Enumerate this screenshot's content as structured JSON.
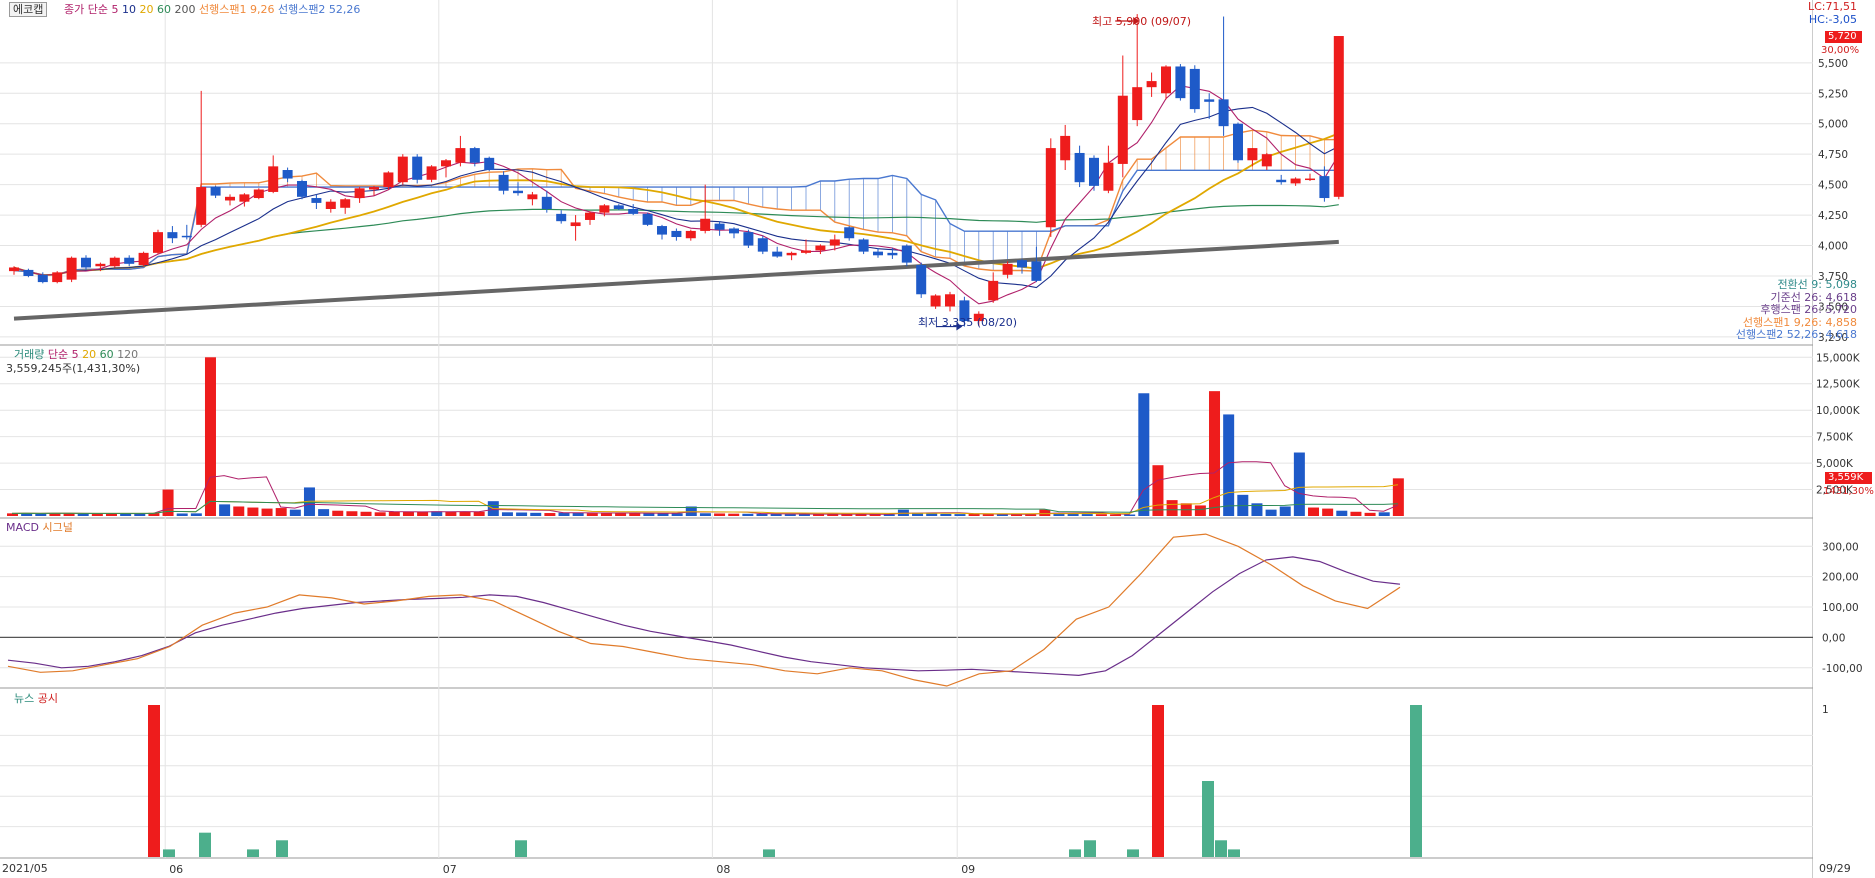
{
  "panels": {
    "price": {
      "stock_button": "에코캡",
      "legend": [
        {
          "text": "종가 단순",
          "color": "#b0206a"
        },
        {
          "text": "5",
          "color": "#b0206a"
        },
        {
          "text": "10",
          "color": "#1a2f8c"
        },
        {
          "text": "20",
          "color": "#e0a800"
        },
        {
          "text": "60",
          "color": "#2e8b57"
        },
        {
          "text": "200",
          "color": "#555555"
        },
        {
          "text": "선행스팬1 9,26",
          "color": "#f08a3c"
        },
        {
          "text": "선행스팬2 52,26",
          "color": "#4a78d0"
        }
      ],
      "lc": "LC:71,51",
      "hc": "HC:-3,05",
      "top_tag": "5,720",
      "top_pct": "30,00%",
      "high_note": "최고 5,900 (09/07)",
      "low_note": "최저 3,335 (08/20)",
      "y_ticks": [
        "5,500",
        "5,250",
        "5,000",
        "4,750",
        "4,500",
        "4,250",
        "4,000",
        "3,750",
        "3,500",
        "3,250"
      ],
      "ichimoku_info": [
        {
          "text": "전환선 9: 5,098",
          "color": "#2f8a8a"
        },
        {
          "text": "기준선 26: 4,618",
          "color": "#6a3f8a"
        },
        {
          "text": "후행스팬 26: 5,720",
          "color": "#6a3f8a"
        },
        {
          "text": "선행스팬1 9,26: 4,858",
          "color": "#f08a3c"
        },
        {
          "text": "선행스팬2 52,26: 4,618",
          "color": "#4a78d0"
        }
      ]
    },
    "volume": {
      "legend": [
        {
          "text": "거래량",
          "color": "#2a8a7a"
        },
        {
          "text": "단순 5",
          "color": "#b0206a"
        },
        {
          "text": "20",
          "color": "#e0a800"
        },
        {
          "text": "60",
          "color": "#2e8b57"
        },
        {
          "text": "120",
          "color": "#777777"
        }
      ],
      "current": "3,559,245주(1,431,30%)",
      "y_ticks": [
        "15,000K",
        "12,500K",
        "10,000K",
        "7,500K",
        "5,000K",
        "2,500K"
      ],
      "tag": "3,559K",
      "tag_pct": "1431,30%"
    },
    "macd": {
      "legend": [
        {
          "text": "MACD",
          "color": "#6a2e8a"
        },
        {
          "text": "시그널",
          "color": "#e07b2a"
        }
      ],
      "y_ticks": [
        "300,00",
        "200,00",
        "100,00",
        "0,00",
        "-100,00"
      ]
    },
    "news": {
      "legend": [
        {
          "text": "뉴스",
          "color": "#2a8a7a"
        },
        {
          "text": "공시",
          "color": "#d02020"
        }
      ],
      "y_tick": "1"
    }
  },
  "x_axis": {
    "labels": [
      "2021/05",
      "06",
      "07",
      "08",
      "09"
    ],
    "end_date": "09/29"
  },
  "colors": {
    "up": "#ee1c1c",
    "down": "#1e5ac8",
    "span1": "#f08a3c",
    "span2": "#4a78d0",
    "ma5": "#b0206a",
    "ma10": "#1a2f8c",
    "ma20": "#e0a800",
    "ma60": "#2e8b57",
    "ma200": "#666666",
    "news": "#4caf8c",
    "disclosure": "#ee1c1c"
  },
  "chart_data": {
    "type": "candlestick",
    "title": "에코캡",
    "price": {
      "ylim": [
        3200,
        5950
      ],
      "candles": [
        {
          "o": 3790,
          "h": 3830,
          "l": 3760,
          "c": 3820
        },
        {
          "o": 3800,
          "h": 3810,
          "l": 3740,
          "c": 3750
        },
        {
          "o": 3760,
          "h": 3780,
          "l": 3690,
          "c": 3700
        },
        {
          "o": 3700,
          "h": 3790,
          "l": 3690,
          "c": 3780
        },
        {
          "o": 3720,
          "h": 3910,
          "l": 3700,
          "c": 3900
        },
        {
          "o": 3900,
          "h": 3920,
          "l": 3800,
          "c": 3820
        },
        {
          "o": 3830,
          "h": 3860,
          "l": 3790,
          "c": 3850
        },
        {
          "o": 3830,
          "h": 3910,
          "l": 3820,
          "c": 3900
        },
        {
          "o": 3900,
          "h": 3920,
          "l": 3830,
          "c": 3850
        },
        {
          "o": 3840,
          "h": 3950,
          "l": 3830,
          "c": 3940
        },
        {
          "o": 3940,
          "h": 4130,
          "l": 3930,
          "c": 4110
        },
        {
          "o": 4110,
          "h": 4160,
          "l": 4020,
          "c": 4060
        },
        {
          "o": 4080,
          "h": 4170,
          "l": 4050,
          "c": 4070
        },
        {
          "o": 4170,
          "h": 5270,
          "l": 4150,
          "c": 4480
        },
        {
          "o": 4480,
          "h": 4490,
          "l": 4390,
          "c": 4410
        },
        {
          "o": 4370,
          "h": 4420,
          "l": 4330,
          "c": 4400
        },
        {
          "o": 4360,
          "h": 4430,
          "l": 4320,
          "c": 4420
        },
        {
          "o": 4390,
          "h": 4470,
          "l": 4380,
          "c": 4460
        },
        {
          "o": 4440,
          "h": 4740,
          "l": 4430,
          "c": 4650
        },
        {
          "o": 4620,
          "h": 4640,
          "l": 4520,
          "c": 4550
        },
        {
          "o": 4530,
          "h": 4540,
          "l": 4380,
          "c": 4400
        },
        {
          "o": 4390,
          "h": 4420,
          "l": 4300,
          "c": 4350
        },
        {
          "o": 4300,
          "h": 4380,
          "l": 4270,
          "c": 4360
        },
        {
          "o": 4310,
          "h": 4390,
          "l": 4260,
          "c": 4380
        },
        {
          "o": 4390,
          "h": 4480,
          "l": 4350,
          "c": 4470
        },
        {
          "o": 4460,
          "h": 4490,
          "l": 4410,
          "c": 4480
        },
        {
          "o": 4480,
          "h": 4610,
          "l": 4460,
          "c": 4600
        },
        {
          "o": 4520,
          "h": 4750,
          "l": 4500,
          "c": 4730
        },
        {
          "o": 4730,
          "h": 4750,
          "l": 4510,
          "c": 4540
        },
        {
          "o": 4540,
          "h": 4660,
          "l": 4520,
          "c": 4650
        },
        {
          "o": 4650,
          "h": 4710,
          "l": 4560,
          "c": 4700
        },
        {
          "o": 4680,
          "h": 4900,
          "l": 4650,
          "c": 4800
        },
        {
          "o": 4800,
          "h": 4810,
          "l": 4650,
          "c": 4680
        },
        {
          "o": 4720,
          "h": 4730,
          "l": 4610,
          "c": 4620
        },
        {
          "o": 4580,
          "h": 4610,
          "l": 4420,
          "c": 4450
        },
        {
          "o": 4450,
          "h": 4520,
          "l": 4410,
          "c": 4430
        },
        {
          "o": 4380,
          "h": 4440,
          "l": 4330,
          "c": 4420
        },
        {
          "o": 4400,
          "h": 4450,
          "l": 4270,
          "c": 4300
        },
        {
          "o": 4260,
          "h": 4290,
          "l": 4180,
          "c": 4200
        },
        {
          "o": 4160,
          "h": 4250,
          "l": 4040,
          "c": 4190
        },
        {
          "o": 4210,
          "h": 4280,
          "l": 4170,
          "c": 4270
        },
        {
          "o": 4270,
          "h": 4340,
          "l": 4240,
          "c": 4330
        },
        {
          "o": 4330,
          "h": 4340,
          "l": 4290,
          "c": 4300
        },
        {
          "o": 4300,
          "h": 4340,
          "l": 4250,
          "c": 4260
        },
        {
          "o": 4260,
          "h": 4270,
          "l": 4160,
          "c": 4170
        },
        {
          "o": 4160,
          "h": 4170,
          "l": 4050,
          "c": 4090
        },
        {
          "o": 4120,
          "h": 4140,
          "l": 4040,
          "c": 4070
        },
        {
          "o": 4060,
          "h": 4130,
          "l": 4040,
          "c": 4120
        },
        {
          "o": 4120,
          "h": 4500,
          "l": 4100,
          "c": 4220
        },
        {
          "o": 4180,
          "h": 4200,
          "l": 4080,
          "c": 4130
        },
        {
          "o": 4140,
          "h": 4150,
          "l": 4060,
          "c": 4100
        },
        {
          "o": 4110,
          "h": 4130,
          "l": 3980,
          "c": 4000
        },
        {
          "o": 4060,
          "h": 4080,
          "l": 3930,
          "c": 3950
        },
        {
          "o": 3950,
          "h": 3990,
          "l": 3900,
          "c": 3910
        },
        {
          "o": 3920,
          "h": 3950,
          "l": 3880,
          "c": 3940
        },
        {
          "o": 3940,
          "h": 4050,
          "l": 3930,
          "c": 3960
        },
        {
          "o": 3960,
          "h": 4010,
          "l": 3930,
          "c": 4000
        },
        {
          "o": 4000,
          "h": 4090,
          "l": 3960,
          "c": 4050
        },
        {
          "o": 4150,
          "h": 4160,
          "l": 4040,
          "c": 4060
        },
        {
          "o": 4050,
          "h": 4060,
          "l": 3930,
          "c": 3950
        },
        {
          "o": 3950,
          "h": 3980,
          "l": 3900,
          "c": 3920
        },
        {
          "o": 3940,
          "h": 3980,
          "l": 3890,
          "c": 3920
        },
        {
          "o": 4000,
          "h": 4010,
          "l": 3830,
          "c": 3860
        },
        {
          "o": 3840,
          "h": 3860,
          "l": 3570,
          "c": 3600
        },
        {
          "o": 3500,
          "h": 3600,
          "l": 3480,
          "c": 3590
        },
        {
          "o": 3500,
          "h": 3620,
          "l": 3460,
          "c": 3600
        },
        {
          "o": 3550,
          "h": 3580,
          "l": 3335,
          "c": 3380
        },
        {
          "o": 3380,
          "h": 3460,
          "l": 3340,
          "c": 3440
        },
        {
          "o": 3550,
          "h": 3780,
          "l": 3530,
          "c": 3710
        },
        {
          "o": 3760,
          "h": 3870,
          "l": 3730,
          "c": 3850
        },
        {
          "o": 3880,
          "h": 3890,
          "l": 3770,
          "c": 3820
        },
        {
          "o": 3870,
          "h": 3990,
          "l": 3700,
          "c": 3710
        },
        {
          "o": 4150,
          "h": 4880,
          "l": 4070,
          "c": 4800
        },
        {
          "o": 4700,
          "h": 4990,
          "l": 4620,
          "c": 4900
        },
        {
          "o": 4760,
          "h": 4820,
          "l": 4480,
          "c": 4520
        },
        {
          "o": 4720,
          "h": 4740,
          "l": 4450,
          "c": 4490
        },
        {
          "o": 4450,
          "h": 4820,
          "l": 4430,
          "c": 4680
        },
        {
          "o": 4670,
          "h": 5560,
          "l": 4560,
          "c": 5230
        },
        {
          "o": 5030,
          "h": 5900,
          "l": 4980,
          "c": 5300
        },
        {
          "o": 5300,
          "h": 5420,
          "l": 5220,
          "c": 5350
        },
        {
          "o": 5250,
          "h": 5480,
          "l": 5200,
          "c": 5470
        },
        {
          "o": 5470,
          "h": 5490,
          "l": 5190,
          "c": 5210
        },
        {
          "o": 5450,
          "h": 5480,
          "l": 5090,
          "c": 5120
        },
        {
          "o": 5200,
          "h": 5250,
          "l": 5040,
          "c": 5180
        },
        {
          "o": 5200,
          "h": 5880,
          "l": 4900,
          "c": 4980
        },
        {
          "o": 5000,
          "h": 5010,
          "l": 4680,
          "c": 4700
        },
        {
          "o": 4700,
          "h": 4800,
          "l": 4650,
          "c": 4800
        },
        {
          "o": 4650,
          "h": 4760,
          "l": 4620,
          "c": 4750
        },
        {
          "o": 4540,
          "h": 4580,
          "l": 4500,
          "c": 4520
        },
        {
          "o": 4510,
          "h": 4560,
          "l": 4490,
          "c": 4550
        },
        {
          "o": 4550,
          "h": 4590,
          "l": 4530,
          "c": 4550
        },
        {
          "o": 4570,
          "h": 4650,
          "l": 4360,
          "c": 4390
        },
        {
          "o": 4400,
          "h": 5720,
          "l": 4380,
          "c": 5720
        }
      ]
    },
    "volume": {
      "ylim": [
        0,
        15500
      ],
      "unit": "K",
      "values": [
        250,
        280,
        220,
        260,
        280,
        200,
        230,
        220,
        240,
        250,
        300,
        2500,
        240,
        250,
        15000,
        1100,
        900,
        800,
        700,
        750,
        600,
        2700,
        650,
        500,
        450,
        400,
        350,
        380,
        420,
        400,
        450,
        380,
        420,
        400,
        1400,
        350,
        330,
        300,
        280,
        310,
        290,
        270,
        260,
        300,
        280,
        260,
        240,
        250,
        900,
        260,
        240,
        220,
        210,
        200,
        190,
        180,
        170,
        160,
        200,
        180,
        170,
        160,
        150,
        600,
        300,
        250,
        200,
        180,
        190,
        170,
        160,
        150,
        140,
        600,
        300,
        200,
        180,
        170,
        150,
        140,
        11600,
        4800,
        1500,
        1200,
        1000,
        11800,
        9600,
        2000,
        1200,
        600,
        900,
        6000,
        800,
        700,
        500,
        400,
        300,
        350,
        3559
      ]
    },
    "macd": {
      "ylim": [
        -160,
        370
      ],
      "macd": [
        -75,
        -85,
        -100,
        -95,
        -80,
        -60,
        -30,
        15,
        40,
        60,
        80,
        95,
        105,
        115,
        120,
        125,
        128,
        132,
        140,
        135,
        115,
        90,
        65,
        40,
        20,
        5,
        -10,
        -25,
        -45,
        -65,
        -80,
        -90,
        -100,
        -105,
        -110,
        -108,
        -105,
        -110,
        -115,
        -120,
        -125,
        -110,
        -60,
        10,
        80,
        150,
        210,
        255,
        265,
        250,
        215,
        185,
        175
      ],
      "signal": [
        -95,
        -115,
        -110,
        -90,
        -70,
        -30,
        40,
        80,
        100,
        140,
        130,
        110,
        120,
        135,
        140,
        120,
        70,
        20,
        -20,
        -30,
        -50,
        -70,
        -80,
        -90,
        -110,
        -120,
        -100,
        -110,
        -140,
        -160,
        -120,
        -110,
        -40,
        60,
        100,
        210,
        330,
        340,
        300,
        240,
        170,
        120,
        95,
        165
      ]
    },
    "news": {
      "ylim": [
        0,
        1
      ],
      "news": [
        0.05,
        0.16,
        0.05,
        0.11,
        0.11,
        0.05,
        0.05,
        0.11,
        0.05,
        0.5,
        0.11,
        0.05,
        0.05,
        1.0
      ],
      "disclosure": [
        1.0,
        1.0
      ]
    }
  }
}
